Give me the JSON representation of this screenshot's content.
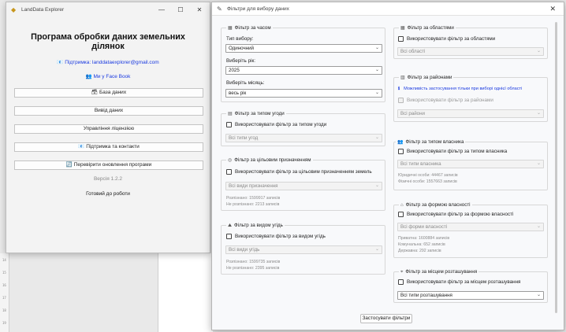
{
  "left_window": {
    "title": "LandData Explorer",
    "controls": {
      "minimize": "—",
      "maximize": "☐",
      "close": "✕"
    },
    "heading": "Програма обробки даних земельних ділянок",
    "support_link": "📧 Підтримка: landdataexplorer@gmail.com",
    "facebook_link": "👥 Ми у Face Book",
    "buttons": [
      "🗃 База даних",
      "Вивід даних",
      "Управління ліцензією",
      "📧 Підтримка та контакти",
      "🔄 Перевірити оновлення програми"
    ],
    "version": "Версія 1.2.2",
    "status": "Готовий до роботи"
  },
  "filter_window": {
    "title": "Фільтри для вибору даних",
    "close": "✕",
    "time_filter": {
      "title": "Фільтр за часом",
      "type_label": "Тип вибору:",
      "type_value": "Одиночний",
      "year_label": "Виберіть рік:",
      "year_value": "2025",
      "month_label": "Виберіть місяць:",
      "month_value": "весь рік"
    },
    "deal_filter": {
      "title": "Фільтр за типом угоди",
      "checkbox": "Використовувати фільтр за типом угоди",
      "select": "Всі типи угод"
    },
    "purpose_filter": {
      "title": "Фільтр за цільовим призначенням",
      "checkbox": "Використовувати фільтр за цільовим призначенням земель",
      "select": "Всі види призначення",
      "stats": [
        "Розпізнано: 1599917 записів",
        "Не розпізнано: 2213 записів"
      ]
    },
    "land_filter": {
      "title": "Фільтр за видом угідь",
      "checkbox": "Використовувати фільтр за видом угідь",
      "select": "Всі види угідь",
      "stats": [
        "Розпізнано: 1599735 записів",
        "Не розпізнано: 2395 записів"
      ]
    },
    "region_filter": {
      "title": "Фільтр за областями",
      "checkbox": "Використовувати фільтр за областями",
      "select": "Всі області"
    },
    "district_filter": {
      "title": "Фільтр за районами",
      "info": "Можливість застосування тільки при виборі однієї області",
      "checkbox": "Використовувати фільтр за районами",
      "select": "Всі райони"
    },
    "owner_filter": {
      "title": "Фільтр за типом власника",
      "checkbox": "Використовувати фільтр за типом власника",
      "select": "Всі типи власника",
      "stats": [
        "Юридичні особи: 44467 записів",
        "Фізичні особи: 1557663 записів"
      ]
    },
    "ownership_filter": {
      "title": "Фільтр за формою власності",
      "checkbox": "Використовувати фільтр за формою власності",
      "select": "Всі форми власності",
      "stats": [
        "Приватна: 1600884 записів",
        "Комунальна: 652 записів",
        "Державна: 292 записів"
      ]
    },
    "location_filter": {
      "title": "Фільтр за місцем розташування",
      "checkbox": "Використовувати фільтр за місцем розташування",
      "select": "Всі типи розташування"
    },
    "apply_button": "Застосувати фільтри"
  },
  "ruler_marks": [
    "14",
    "15",
    "16",
    "17",
    "18",
    "19"
  ]
}
